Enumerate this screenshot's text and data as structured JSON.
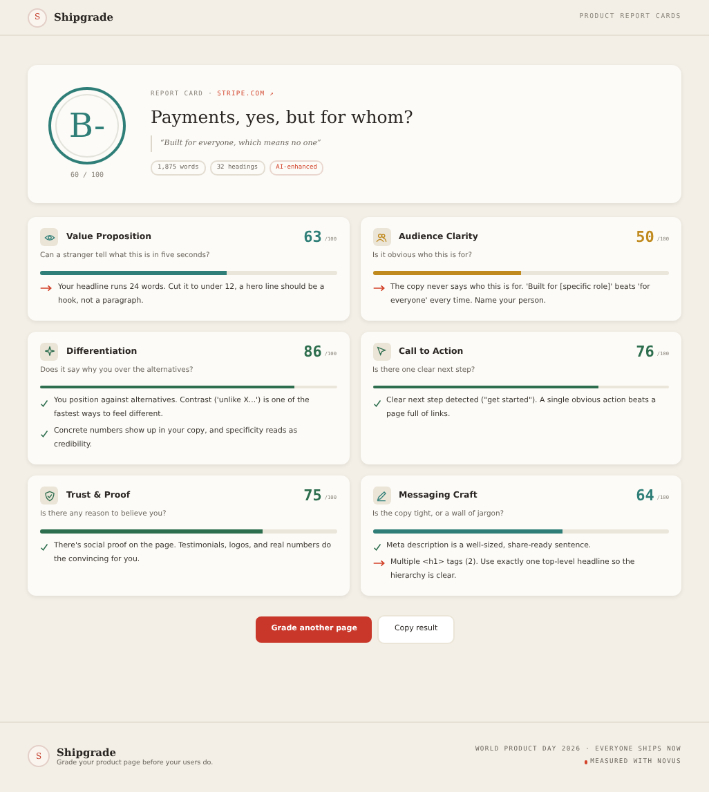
{
  "header": {
    "brand_mark": "S",
    "brand": "Shipgrade",
    "nav": "PRODUCT REPORT CARDS"
  },
  "report": {
    "grade": "B-",
    "score": "60 / 100",
    "eyebrow": "REPORT CARD ·",
    "site": "STRIPE.COM ↗",
    "title": "Payments, yes, but for whom?",
    "quote": "“Built for everyone, which means no one”",
    "tags": [
      {
        "label": "1,875 words",
        "kind": "plain"
      },
      {
        "label": "32 headings",
        "kind": "plain"
      },
      {
        "label": "AI-enhanced",
        "kind": "accent"
      }
    ]
  },
  "categories": [
    {
      "title": "Value Proposition",
      "score": "63",
      "out_of": "/100",
      "level": 0.63,
      "color": "#2f7f78",
      "question": "Can a stranger tell what this is in five seconds?",
      "findings": [
        {
          "kind": "issue",
          "text": "Your headline runs 24 words. Cut it to under 12, a hero line should be a hook, not a paragraph."
        }
      ]
    },
    {
      "title": "Audience Clarity",
      "score": "50",
      "out_of": "/100",
      "level": 0.5,
      "color": "#c08a1e",
      "question": "Is it obvious who this is for?",
      "findings": [
        {
          "kind": "issue",
          "text": "The copy never says who this is for. 'Built for [specific role]' beats 'for everyone' every time. Name your person."
        }
      ]
    },
    {
      "title": "Differentiation",
      "score": "86",
      "out_of": "/100",
      "level": 0.86,
      "color": "#2d6e4e",
      "question": "Does it say why you over the alternatives?",
      "findings": [
        {
          "kind": "pass",
          "text": "You position against alternatives. Contrast ('unlike X...') is one of the fastest ways to feel different."
        },
        {
          "kind": "pass",
          "text": "Concrete numbers show up in your copy, and specificity reads as credibility."
        }
      ]
    },
    {
      "title": "Call to Action",
      "score": "76",
      "out_of": "/100",
      "level": 0.76,
      "color": "#2d6e4e",
      "question": "Is there one clear next step?",
      "findings": [
        {
          "kind": "pass",
          "text": "Clear next step detected (\"get started\"). A single obvious action beats a page full of links."
        }
      ]
    },
    {
      "title": "Trust & Proof",
      "score": "75",
      "out_of": "/100",
      "level": 0.75,
      "color": "#2d6e4e",
      "question": "Is there any reason to believe you?",
      "findings": [
        {
          "kind": "pass",
          "text": "There's social proof on the page. Testimonials, logos, and real numbers do the convincing for you."
        }
      ]
    },
    {
      "title": "Messaging Craft",
      "score": "64",
      "out_of": "/100",
      "level": 0.64,
      "color": "#2f7f78",
      "question": "Is the copy tight, or a wall of jargon?",
      "findings": [
        {
          "kind": "pass",
          "text": "Meta description is a well-sized, share-ready sentence."
        },
        {
          "kind": "issue",
          "text": "Multiple <h1> tags (2). Use exactly one top-level headline so the hierarchy is clear."
        }
      ]
    }
  ],
  "actions": {
    "primary": "Grade another page",
    "secondary": "Copy result"
  },
  "footer": {
    "brand_mark": "S",
    "brand": "Shipgrade",
    "tagline": "Grade your product page before your users do.",
    "line_1": "WORLD PRODUCT DAY 2026 · EVERYONE SHIPS NOW",
    "line_2": "MEASURED WITH NOVUS"
  }
}
